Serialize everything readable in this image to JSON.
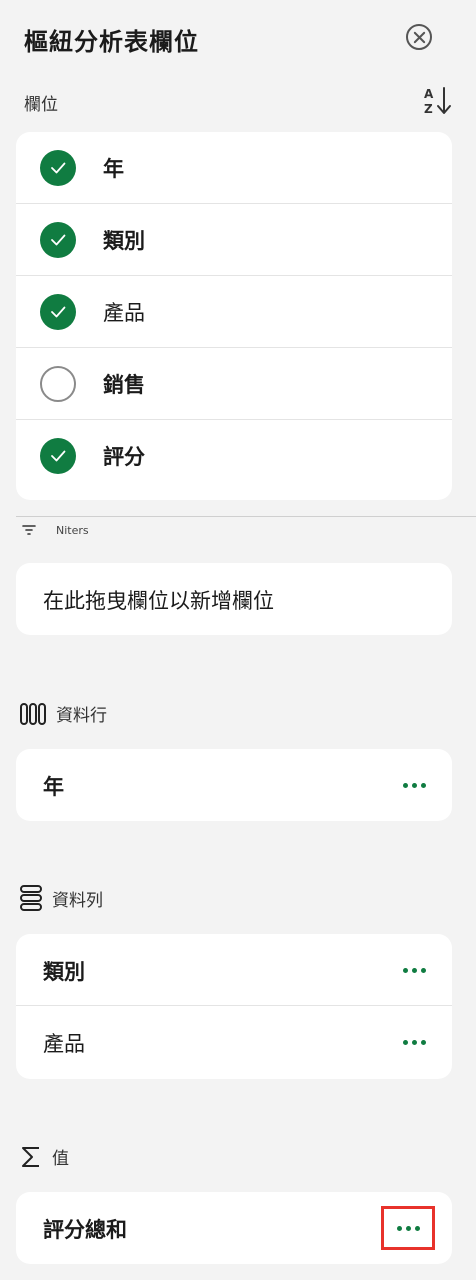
{
  "header": {
    "title": "樞紐分析表欄位",
    "close_icon": "close-circle-icon"
  },
  "fields_section": {
    "label": "欄位",
    "sort_icon": "sort-az-icon",
    "items": [
      {
        "label": "年",
        "checked": true
      },
      {
        "label": "類別",
        "checked": true
      },
      {
        "label": "產品",
        "checked": true
      },
      {
        "label": "銷售",
        "checked": false
      },
      {
        "label": "評分",
        "checked": true
      }
    ]
  },
  "filters": {
    "label": "Niters",
    "drop_placeholder": "在此拖曳欄位以新增欄位"
  },
  "columns": {
    "label": "資料行",
    "items": [
      "年"
    ]
  },
  "rows": {
    "label": "資料列",
    "items": [
      "類別",
      "產品"
    ]
  },
  "values": {
    "label": "值",
    "items": [
      "評分總和"
    ]
  },
  "colors": {
    "accent": "#107c41",
    "highlight": "#e8322b"
  }
}
